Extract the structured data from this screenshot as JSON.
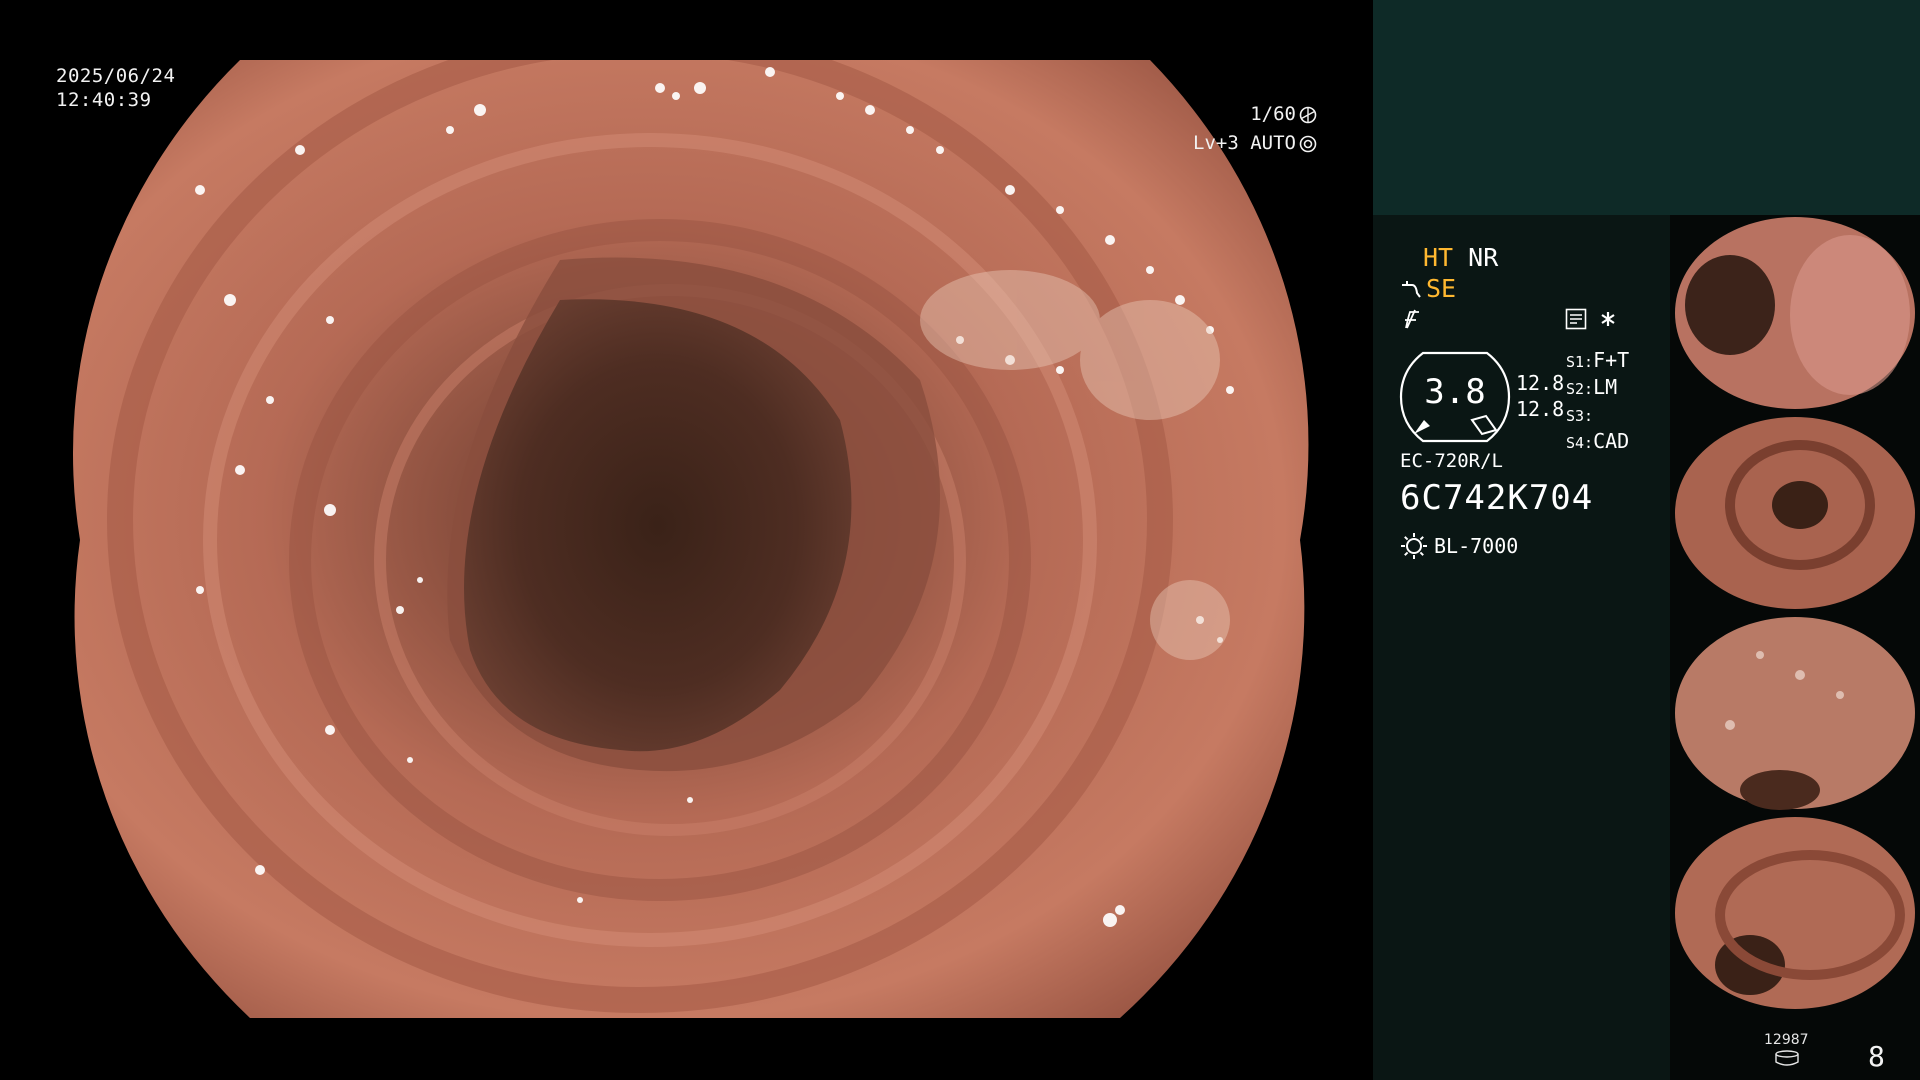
{
  "overlay": {
    "date": "2025/06/24",
    "time": "12:40:39",
    "shutter": "1/60",
    "level_mode": "Lv+3 AUTO"
  },
  "enhancement": {
    "ht": "HT",
    "nr": "NR",
    "se": "SE"
  },
  "zoom": {
    "value": "3.8",
    "line1": "12.8",
    "line2": "12.8"
  },
  "slots": [
    {
      "label": "S1:",
      "value": "F+T"
    },
    {
      "label": "S2:",
      "value": "LM"
    },
    {
      "label": "S3:",
      "value": ""
    },
    {
      "label": "S4:",
      "value": "CAD"
    }
  ],
  "scope": {
    "model": "EC-720R/L",
    "serial": "6C742K704",
    "light_source": "BL-7000"
  },
  "status": {
    "counter": "12987",
    "page": "8"
  },
  "colors": {
    "accent_orange": "#ffb830",
    "panel_top": "#0e2a27",
    "panel": "#0a1614"
  },
  "icons": [
    "shutter-icon",
    "auto-iris-icon",
    "structure-enhance-icon",
    "color-enhance-icon",
    "record-icon",
    "asterisk-icon",
    "light-source-icon",
    "database-icon"
  ]
}
